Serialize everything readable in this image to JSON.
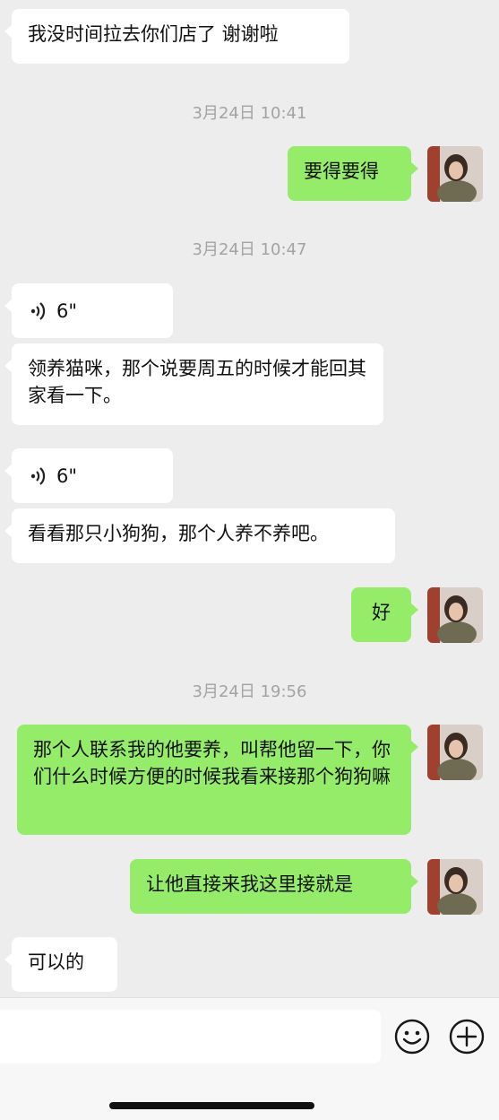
{
  "messages": {
    "m1": "我没时间拉去你们店了  谢谢啦",
    "t1": "3月24日 10:41",
    "m2": "要得要得",
    "t2": "3月24日 10:47",
    "v1": "6\"",
    "m3": "领养猫咪，那个说要周五的时候才能回其家看一下。",
    "v2": "6\"",
    "m4": "看看那只小狗狗，那个人养不养吧。",
    "m5": "好",
    "t3": "3月24日 19:56",
    "m6": "那个人联系我的他要养，叫帮他留一下，你们什么时候方便的时候我看来接那个狗狗嘛",
    "m7": "让他直接来我这里接就是",
    "m8": "可以的"
  },
  "icons": {
    "voice": "voice-wave-icon",
    "emoji": "emoji-icon",
    "add": "plus-icon"
  },
  "colors": {
    "incoming": "#ffffff",
    "outgoing": "#95ec69",
    "background": "#ededed",
    "timestamp": "#a3a3a3"
  }
}
